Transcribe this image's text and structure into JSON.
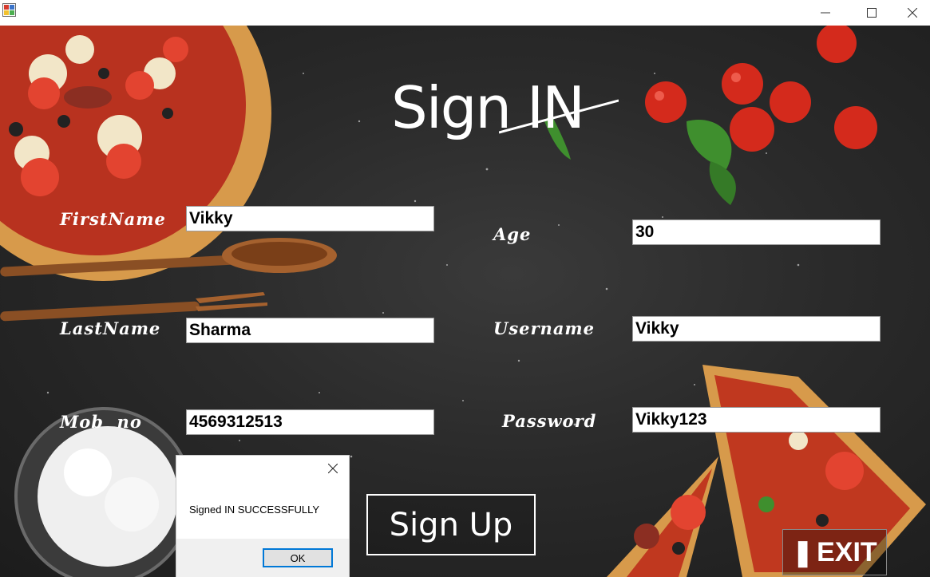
{
  "window": {
    "title": "",
    "controls": {
      "minimize_icon": "minimize-icon",
      "maximize_icon": "maximize-icon",
      "close_icon": "close-icon"
    }
  },
  "form": {
    "title": "Sign IN",
    "fields": {
      "first_name": {
        "label": "FirstName",
        "value": "Vikky"
      },
      "last_name": {
        "label": "LastName",
        "value": "Sharma"
      },
      "mobile": {
        "label": "Mob  no",
        "value": "4569312513"
      },
      "age": {
        "label": "Age",
        "value": "30"
      },
      "username": {
        "label": "Username",
        "value": "Vikky"
      },
      "password": {
        "label": "Password",
        "value": "Vikky123"
      }
    },
    "signup_button": "Sign Up",
    "exit_button": "EXIT"
  },
  "message_box": {
    "text": "Signed IN SUCCESSFULLY",
    "ok_button": "OK"
  },
  "colors": {
    "background": "#2a2a2a",
    "text": "#ffffff",
    "field_bg": "#ffffff",
    "ok_border": "#0078d7",
    "tomato": "#d42a1c",
    "basil": "#3f8f2e",
    "pizza_crust": "#d79a4b",
    "wood": "#8a4f24"
  }
}
